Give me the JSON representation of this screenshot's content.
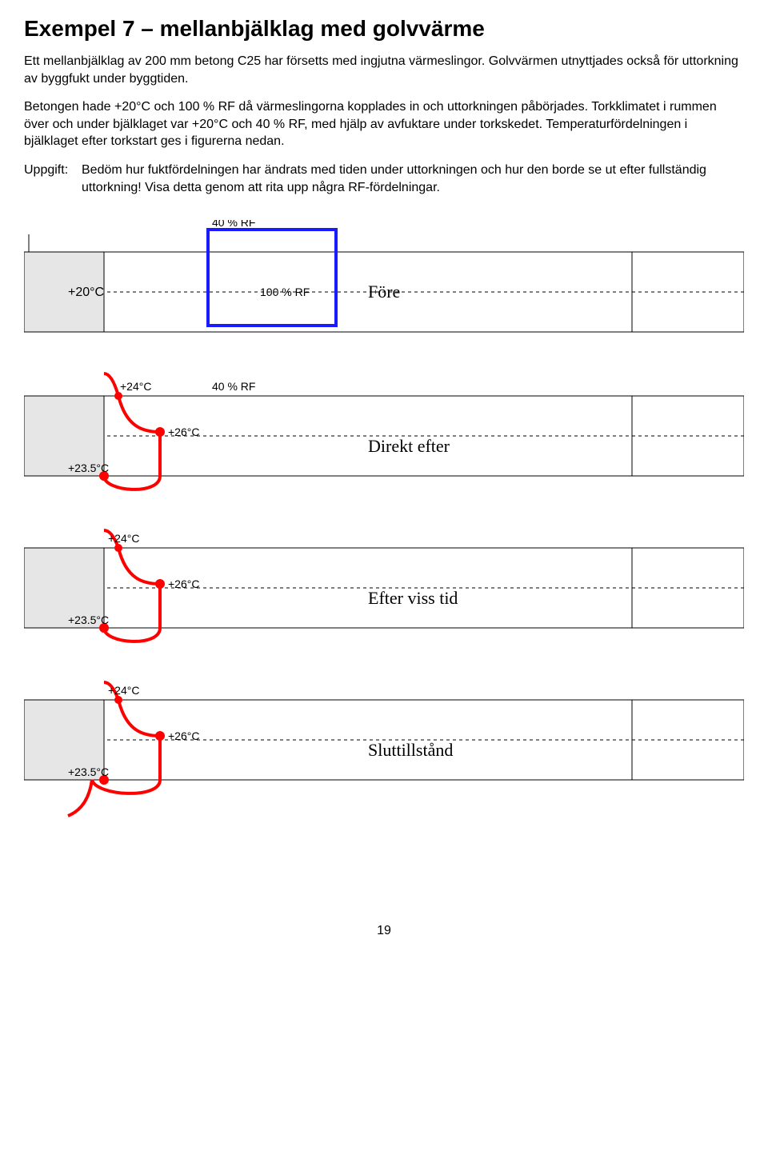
{
  "title": "Exempel 7 – mellanbjälklag med golvvärme",
  "para1": "Ett mellanbjälklag av 200 mm betong C25 har försetts med ingjutna värmeslingor. Golvvärmen utnyttjades också för uttorkning av byggfukt under byggtiden.",
  "para2": "Betongen hade +20°C och 100 % RF då värmeslingorna kopplades in och uttorkningen påbörjades. Torkklimatet i rummen över och under bjälklaget var +20°C och 40 % RF, med hjälp av avfuktare under torkskedet. Temperaturfördelningen i bjälklaget efter torkstart ges i figurerna nedan.",
  "taskLabel": "Uppgift:",
  "taskText": "Bedöm hur fuktfördelningen har ändrats med tiden under uttorkningen och hur den borde se ut efter fullständig uttorkning! Visa detta genom att rita upp några RF-fördelningar.",
  "labels": {
    "rf40": "40 % RF",
    "rf100": "100 % RF",
    "t20": "+20°C",
    "t24": "+24°C",
    "t26": "+26°C",
    "t235": "+23.5°C",
    "fore": "Före",
    "direkt": "Direkt efter",
    "efter": "Efter viss tid",
    "slut": "Sluttillstånd"
  },
  "pageNumber": "19"
}
